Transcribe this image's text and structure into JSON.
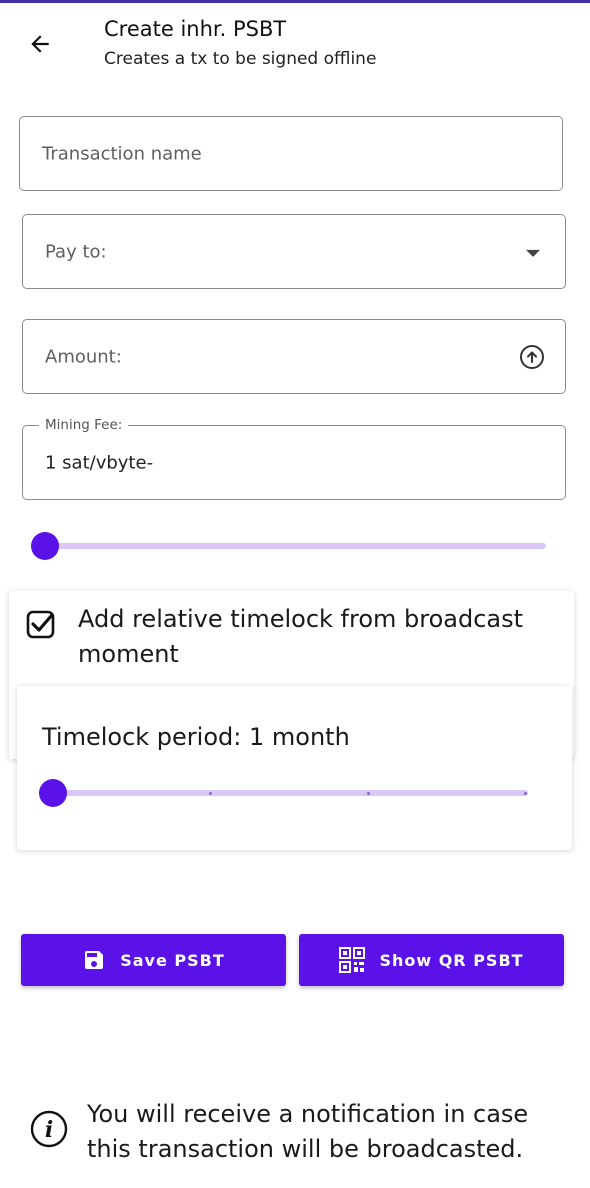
{
  "header": {
    "title": "Create inhr. PSBT",
    "subtitle": "Creates a tx to be signed offline",
    "back_icon": "arrow-left-icon"
  },
  "form": {
    "transaction_name": {
      "placeholder": "Transaction name",
      "value": ""
    },
    "pay_to": {
      "placeholder": "Pay to:",
      "icon": "dropdown-arrow-icon"
    },
    "amount": {
      "placeholder": "Amount:",
      "icon": "arrow-up-circle-icon"
    },
    "mining_fee": {
      "label": "Mining Fee:",
      "value": "1 sat/vbyte-"
    },
    "fee_slider": {
      "value_fraction": 0.0
    }
  },
  "timelock": {
    "checkbox_checked": true,
    "checkbox_label": "Add relative timelock from broadcast moment",
    "period_label": "Timelock period",
    "period_separator": ":",
    "period_value": "1 month",
    "period_slider": {
      "value_fraction": 0.0,
      "steps": 4
    }
  },
  "buttons": {
    "save": {
      "label": "Save PSBT",
      "icon": "floppy-disk-icon"
    },
    "show_qr": {
      "label": "Show QR PSBT",
      "icon": "qr-code-icon"
    }
  },
  "info": {
    "icon": "info-icon",
    "text": "You will receive a notification in case this transaction will be broadcasted."
  },
  "colors": {
    "accent": "#5b12e8",
    "slider_track": "#d9c8f7",
    "top_bar": "#3f2fa8"
  }
}
